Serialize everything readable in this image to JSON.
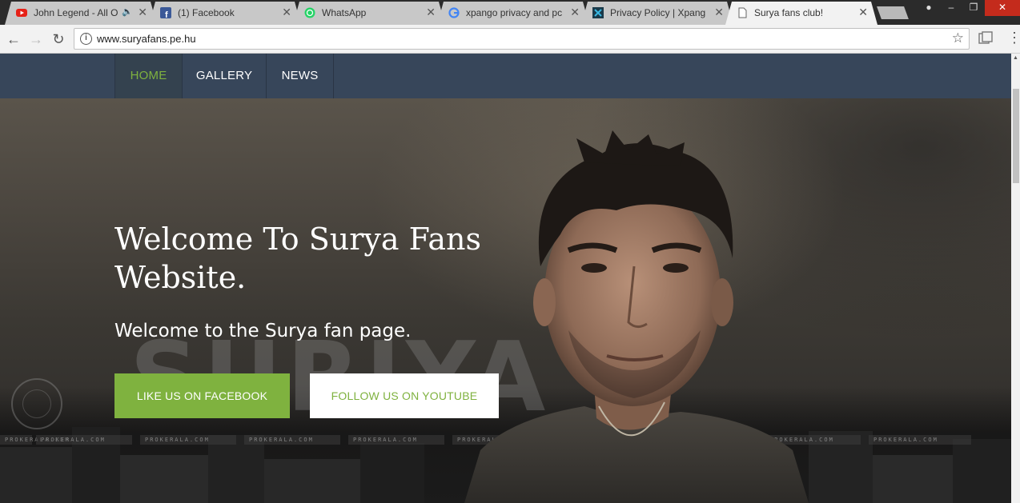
{
  "browser": {
    "tabs": [
      {
        "title": "John Legend - All O",
        "favicon": "youtube-icon",
        "audio": true,
        "active": false
      },
      {
        "title": "(1) Facebook",
        "favicon": "facebook-icon",
        "audio": false,
        "active": false
      },
      {
        "title": "WhatsApp",
        "favicon": "whatsapp-icon",
        "audio": false,
        "active": false
      },
      {
        "title": "xpango privacy and pc",
        "favicon": "google-icon",
        "audio": false,
        "active": false
      },
      {
        "title": "Privacy Policy | Xpang",
        "favicon": "xpango-icon",
        "audio": false,
        "active": false
      },
      {
        "title": "Surya fans club!",
        "favicon": "page-icon",
        "audio": false,
        "active": true
      }
    ],
    "address": "www.suryafans.pe.hu"
  },
  "site": {
    "nav": [
      {
        "label": "HOME",
        "active": true
      },
      {
        "label": "GALLERY",
        "active": false
      },
      {
        "label": "NEWS",
        "active": false
      }
    ],
    "hero": {
      "title": "Welcome To Surya Fans Website.",
      "subtitle": "Welcome to the Surya fan page.",
      "background_text": "SURIYA",
      "watermark": "PROKERALA.COM",
      "buttons": {
        "facebook": "LIKE US ON FACEBOOK",
        "youtube": "FOLLOW US ON YOUTUBE"
      }
    }
  },
  "colors": {
    "accent": "#7fb23f",
    "nav_bg": "#37465a",
    "tab_active": "#f2f2f2",
    "tab_inactive": "#c8c8c8"
  }
}
